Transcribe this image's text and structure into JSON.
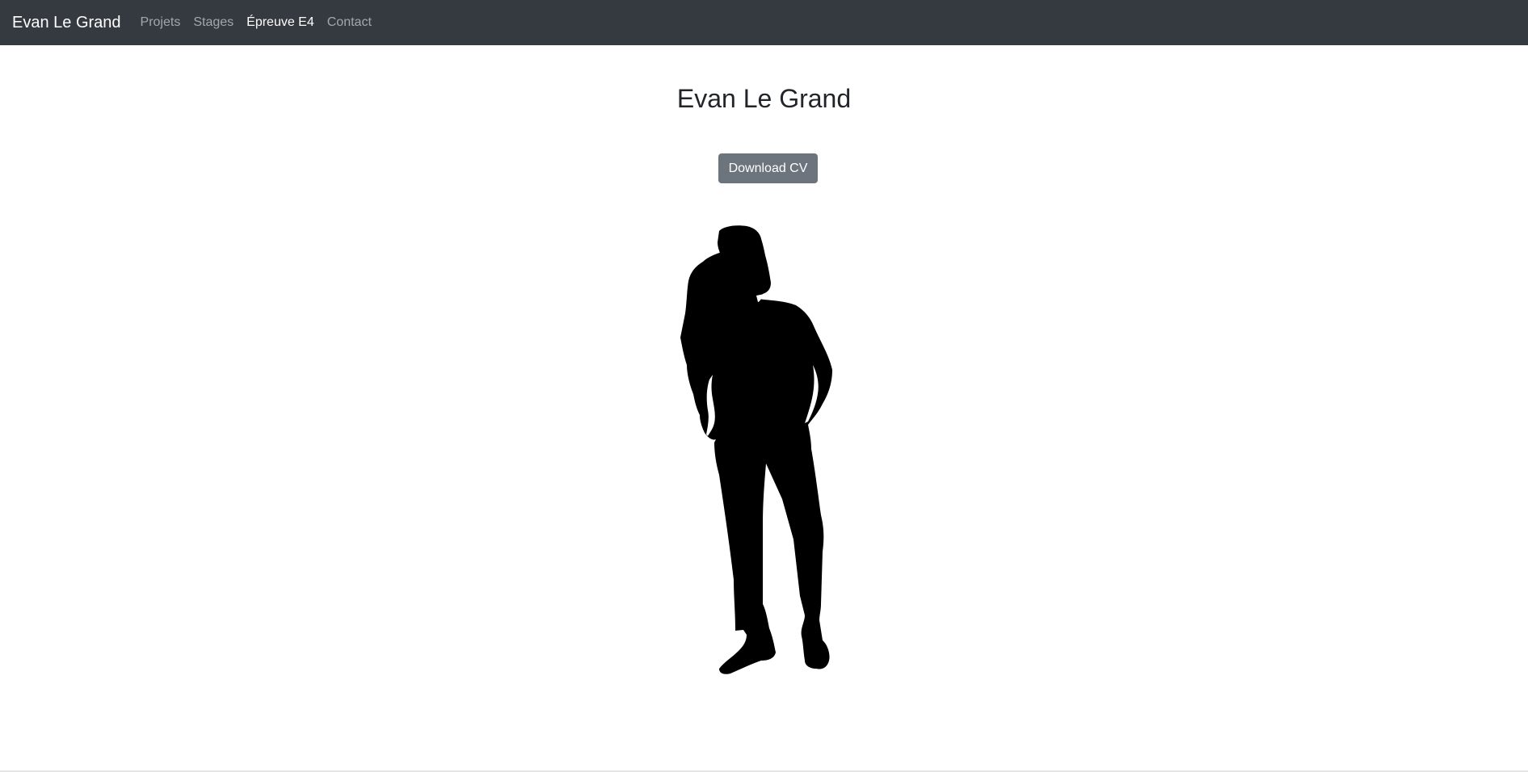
{
  "navbar": {
    "brand": "Evan Le Grand",
    "links": [
      {
        "label": "Projets",
        "active": false
      },
      {
        "label": "Stages",
        "active": false
      },
      {
        "label": "Épreuve E4",
        "active": true
      },
      {
        "label": "Contact",
        "active": false
      }
    ],
    "background_color": "#343a40"
  },
  "main": {
    "title": "Evan Le Grand",
    "download_button": {
      "label": "Download CV",
      "color": "#6c757d"
    },
    "image": {
      "icon": "person-silhouette",
      "color": "#000000"
    }
  }
}
